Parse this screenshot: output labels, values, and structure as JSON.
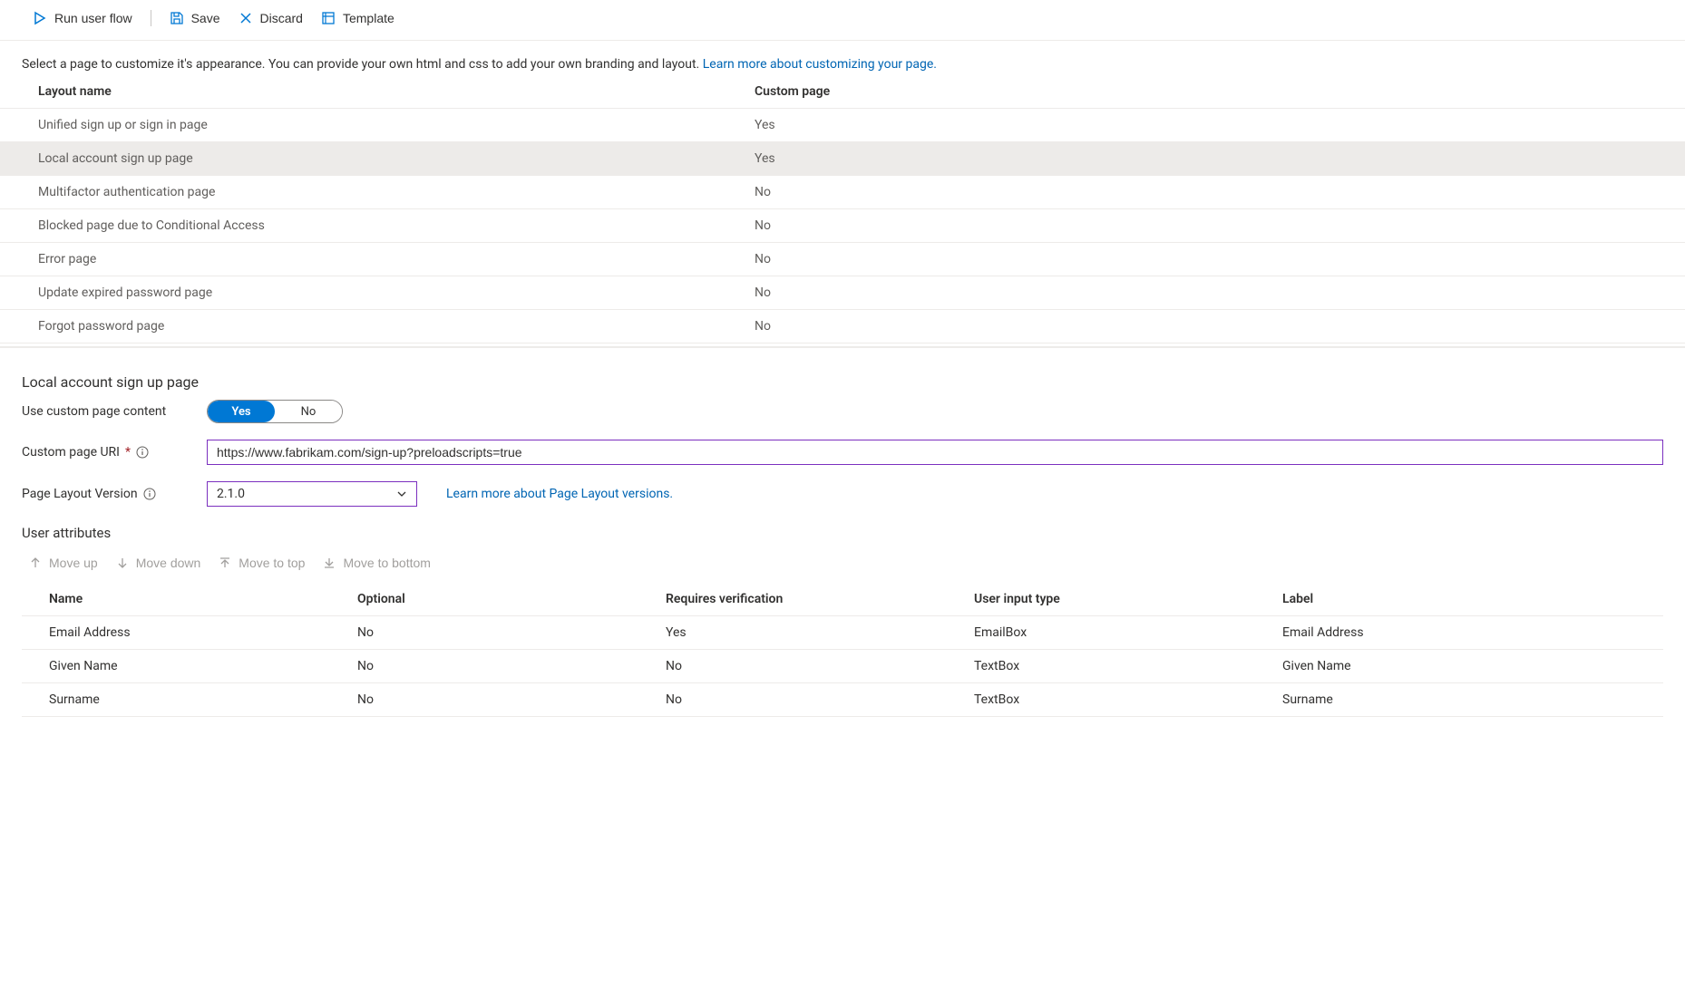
{
  "toolbar": {
    "run": "Run user flow",
    "save": "Save",
    "discard": "Discard",
    "template": "Template"
  },
  "intro": {
    "text": "Select a page to customize it's appearance. You can provide your own html and css to add your own branding and layout. ",
    "link": "Learn more about customizing your page."
  },
  "layouts": {
    "headers": {
      "name": "Layout name",
      "custom": "Custom page"
    },
    "rows": [
      {
        "name": "Unified sign up or sign in page",
        "custom": "Yes",
        "selected": false
      },
      {
        "name": "Local account sign up page",
        "custom": "Yes",
        "selected": true
      },
      {
        "name": "Multifactor authentication page",
        "custom": "No",
        "selected": false
      },
      {
        "name": "Blocked page due to Conditional Access",
        "custom": "No",
        "selected": false
      },
      {
        "name": "Error page",
        "custom": "No",
        "selected": false
      },
      {
        "name": "Update expired password page",
        "custom": "No",
        "selected": false
      },
      {
        "name": "Forgot password page",
        "custom": "No",
        "selected": false
      }
    ]
  },
  "detail": {
    "title": "Local account sign up page",
    "useCustom": {
      "label": "Use custom page content",
      "yes": "Yes",
      "no": "No",
      "value": "Yes"
    },
    "uri": {
      "label": "Custom page URI",
      "value": "https://www.fabrikam.com/sign-up?preloadscripts=true"
    },
    "version": {
      "label": "Page Layout Version",
      "value": "2.1.0",
      "link": "Learn more about Page Layout versions."
    },
    "attrs": {
      "title": "User attributes",
      "toolbar": {
        "up": "Move up",
        "down": "Move down",
        "top": "Move to top",
        "bottom": "Move to bottom"
      },
      "headers": {
        "name": "Name",
        "optional": "Optional",
        "verify": "Requires verification",
        "input": "User input type",
        "label": "Label"
      },
      "rows": [
        {
          "name": "Email Address",
          "optional": "No",
          "verify": "Yes",
          "input": "EmailBox",
          "label": "Email Address"
        },
        {
          "name": "Given Name",
          "optional": "No",
          "verify": "No",
          "input": "TextBox",
          "label": "Given Name"
        },
        {
          "name": "Surname",
          "optional": "No",
          "verify": "No",
          "input": "TextBox",
          "label": "Surname"
        }
      ]
    }
  }
}
